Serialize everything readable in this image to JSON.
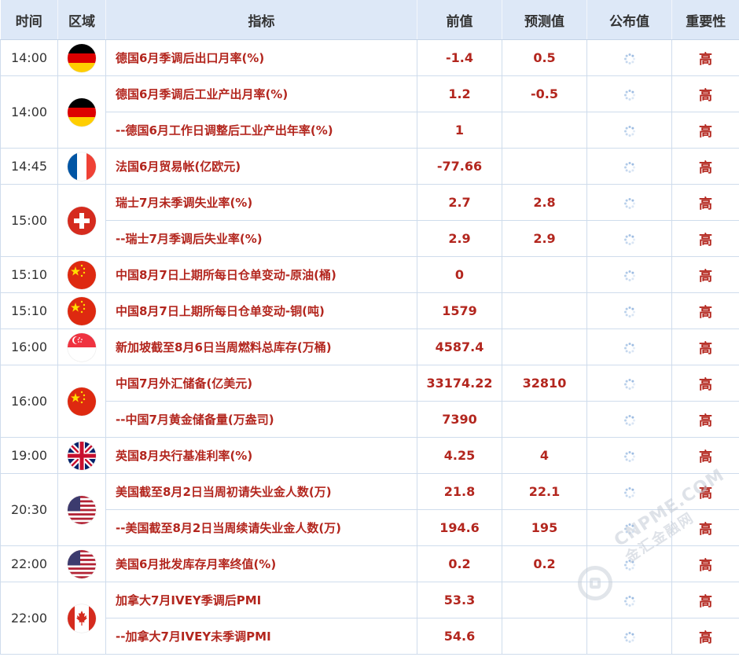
{
  "columns": [
    "时间",
    "区域",
    "指标",
    "前值",
    "预测值",
    "公布值",
    "重要性"
  ],
  "pending_icon": "loading-spinner-icon",
  "colors": {
    "value_red": "#b3261e",
    "header_bg": "#dde8f7",
    "border": "#cfdcec"
  },
  "rows": [
    {
      "time": "14:00",
      "flag": "germany",
      "indicator": "德国6月季调后出口月率(%)",
      "prev": "-1.4",
      "forecast": "0.5",
      "importance": "高"
    },
    {
      "time": "14:00",
      "flag": "germany",
      "indicator": "德国6月季调后工业产出月率(%)",
      "prev": "1.2",
      "forecast": "-0.5",
      "importance": "高"
    },
    {
      "time": "",
      "flag": "",
      "indicator": "--德国6月工作日调整后工业产出年率(%)",
      "prev": "1",
      "forecast": "",
      "importance": "高"
    },
    {
      "time": "14:45",
      "flag": "france",
      "indicator": "法国6月贸易帐(亿欧元)",
      "prev": "-77.66",
      "forecast": "",
      "importance": "高"
    },
    {
      "time": "15:00",
      "flag": "switzerland",
      "indicator": "瑞士7月未季调失业率(%)",
      "prev": "2.7",
      "forecast": "2.8",
      "importance": "高"
    },
    {
      "time": "",
      "flag": "",
      "indicator": "--瑞士7月季调后失业率(%)",
      "prev": "2.9",
      "forecast": "2.9",
      "importance": "高"
    },
    {
      "time": "15:10",
      "flag": "china",
      "indicator": "中国8月7日上期所每日仓单变动-原油(桶)",
      "prev": "0",
      "forecast": "",
      "importance": "高"
    },
    {
      "time": "15:10",
      "flag": "china",
      "indicator": "中国8月7日上期所每日仓单变动-铜(吨)",
      "prev": "1579",
      "forecast": "",
      "importance": "高"
    },
    {
      "time": "16:00",
      "flag": "singapore",
      "indicator": "新加坡截至8月6日当周燃料总库存(万桶)",
      "prev": "4587.4",
      "forecast": "",
      "importance": "高"
    },
    {
      "time": "16:00",
      "flag": "china",
      "indicator": "中国7月外汇储备(亿美元)",
      "prev": "33174.22",
      "forecast": "32810",
      "importance": "高"
    },
    {
      "time": "",
      "flag": "",
      "indicator": "--中国7月黄金储备量(万盎司)",
      "prev": "7390",
      "forecast": "",
      "importance": "高"
    },
    {
      "time": "19:00",
      "flag": "uk",
      "indicator": "英国8月央行基准利率(%)",
      "prev": "4.25",
      "forecast": "4",
      "importance": "高"
    },
    {
      "time": "20:30",
      "flag": "usa",
      "indicator": "美国截至8月2日当周初请失业金人数(万)",
      "prev": "21.8",
      "forecast": "22.1",
      "importance": "高"
    },
    {
      "time": "",
      "flag": "",
      "indicator": "--美国截至8月2日当周续请失业金人数(万)",
      "prev": "194.6",
      "forecast": "195",
      "importance": "高"
    },
    {
      "time": "22:00",
      "flag": "usa",
      "indicator": "美国6月批发库存月率终值(%)",
      "prev": "0.2",
      "forecast": "0.2",
      "importance": "高"
    },
    {
      "time": "22:00",
      "flag": "canada",
      "indicator": "加拿大7月IVEY季调后PMI",
      "prev": "53.3",
      "forecast": "",
      "importance": "高"
    },
    {
      "time": "",
      "flag": "",
      "indicator": "--加拿大7月IVEY未季调PMI",
      "prev": "54.6",
      "forecast": "",
      "importance": "高"
    }
  ],
  "watermark": {
    "en": "CNPME.COM",
    "cn": "金汇金融网"
  }
}
